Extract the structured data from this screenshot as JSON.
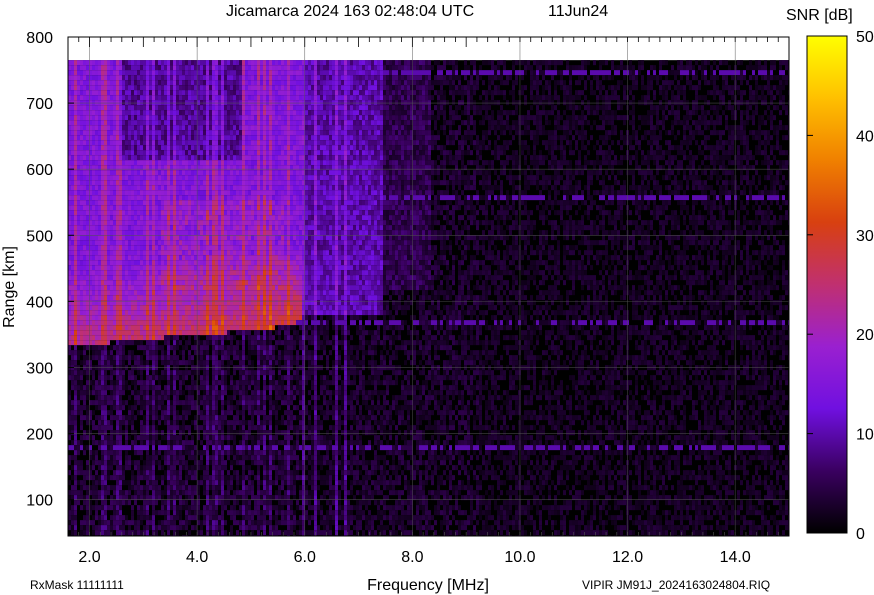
{
  "chart_data": {
    "type": "heatmap",
    "title_left": "Jicamarca 2024 163 02:48:04 UTC",
    "title_right": "11Jun24",
    "xlabel": "Frequency [MHz]",
    "ylabel": "Range [km]",
    "xlim": [
      1.6,
      15.0
    ],
    "ylim": [
      45,
      800
    ],
    "x_ticks": [
      2.0,
      4.0,
      6.0,
      8.0,
      10.0,
      12.0,
      14.0
    ],
    "x_tick_labels": [
      "2.0",
      "4.0",
      "6.0",
      "8.0",
      "10.0",
      "12.0",
      "14.0"
    ],
    "y_ticks": [
      100,
      200,
      300,
      400,
      500,
      600,
      700,
      800
    ],
    "y_tick_labels": [
      "100",
      "200",
      "300",
      "400",
      "500",
      "600",
      "700",
      "800"
    ],
    "colorbar": {
      "label": "SNR [dB]",
      "range": [
        0,
        50
      ],
      "ticks": [
        0,
        10,
        20,
        30,
        40,
        50
      ],
      "tick_labels": [
        "0",
        "10",
        "20",
        "30",
        "40",
        "50"
      ],
      "colormap": [
        "#000000",
        "#3a0060",
        "#7010e0",
        "#9a20d0",
        "#c03070",
        "#d84010",
        "#f08000",
        "#ffc000",
        "#ffff00"
      ]
    },
    "data_top_km": 765,
    "grid": true,
    "echo_trace": {
      "description_freq_mhz": [
        1.6,
        2.5,
        3.5,
        4.5,
        5.5,
        5.8
      ],
      "virtual_height_km": [
        338,
        342,
        350,
        356,
        365,
        372
      ]
    },
    "interference_rows_km": [
      183,
      370,
      560,
      748
    ]
  },
  "footer": {
    "left": "RxMask 11111111",
    "right": "VIPIR  JM91J_2024163024804.RIQ"
  }
}
